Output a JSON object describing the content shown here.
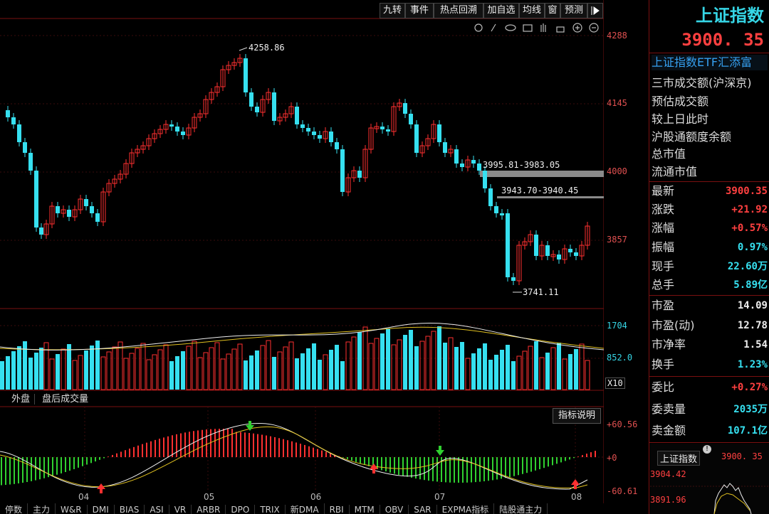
{
  "toolbar": {
    "buttons": [
      "九转",
      "事件",
      "热点回溯",
      "加自选",
      "均线",
      "窗",
      "预测"
    ]
  },
  "price_chart": {
    "axis_labels": [
      "4288",
      "4145",
      "4000",
      "3857"
    ],
    "annotations": {
      "high": "4258.86",
      "low": "3741.11",
      "gap1": "3995.81-3983.05",
      "gap2": "3943.70-3940.45"
    }
  },
  "volume_chart": {
    "axis_labels": [
      "1704",
      "852.0"
    ],
    "unit": "X10"
  },
  "indicator": {
    "tabs": [
      "外盘",
      "盘后成交量"
    ],
    "explain_button": "指标说明",
    "axis_labels": [
      "+60.56",
      "+0",
      "-60.61"
    ],
    "month_labels": [
      "04",
      "05",
      "06",
      "07",
      "08"
    ]
  },
  "bottom_tabs": [
    "停数",
    "主力",
    "W&R",
    "DMI",
    "BIAS",
    "ASI",
    "VR",
    "ARBR",
    "DPO",
    "TRIX",
    "新DMA",
    "RBI",
    "MTM",
    "OBV",
    "SAR",
    "EXPMA指标",
    "陆股通主力"
  ],
  "panel": {
    "title": "上证指数",
    "price": "3900. 35",
    "etf_link": "上证指数ETF汇添富",
    "info_rows": [
      "三市成交额(沪深京)",
      "预估成交额",
      "较上日此时",
      "沪股通额度余额",
      "总市值",
      "流通市值"
    ],
    "quote": [
      {
        "k": "最新",
        "v": "3900.35",
        "c": "red"
      },
      {
        "k": "涨跌",
        "v": "+21.92",
        "c": "red"
      },
      {
        "k": "涨幅",
        "v": "+0.57%",
        "c": "red"
      },
      {
        "k": "振幅",
        "v": "0.97%",
        "c": "cyan"
      },
      {
        "k": "现手",
        "v": "22.60万",
        "c": "cyan"
      },
      {
        "k": "总手",
        "v": "5.89亿",
        "c": "cyan"
      }
    ],
    "valuation": [
      {
        "k": "市盈",
        "v": "14.09",
        "c": "white"
      },
      {
        "k": "市盈(动)",
        "v": "12.78",
        "c": "white"
      },
      {
        "k": "市净率",
        "v": "1.54",
        "c": "white"
      },
      {
        "k": "换手",
        "v": "1.23%",
        "c": "cyan"
      }
    ],
    "orders": [
      {
        "k": "委比",
        "v": "+0.27%",
        "c": "red"
      },
      {
        "k": "委卖量",
        "v": "2035万",
        "c": "cyan"
      },
      {
        "k": "卖金额",
        "v": "107.1亿",
        "c": "cyan"
      }
    ],
    "mini": {
      "title": "上证指数",
      "price": "3900. 35",
      "high": "3904.42",
      "low": "3891.96"
    }
  }
}
